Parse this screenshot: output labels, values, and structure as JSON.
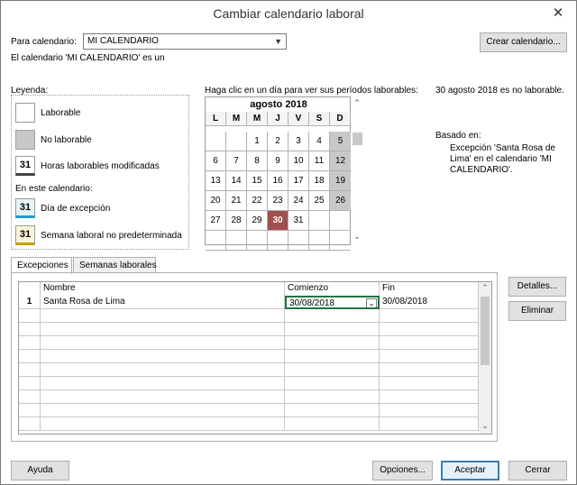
{
  "title": "Cambiar calendario laboral",
  "close_glyph": "✕",
  "for_calendar_label": "Para calendario:",
  "calendar_value": "MI CALENDARIO",
  "create_calendar_button": "Crear calendario...",
  "calendar_info": "El calendario 'MI CALENDARIO' es un",
  "legend": {
    "title": "Leyenda:",
    "items": [
      {
        "swatch": "",
        "label": "Laborable"
      },
      {
        "swatch": "",
        "label": "No laborable"
      },
      {
        "swatch": "31",
        "label": "Horas laborables modificadas"
      }
    ],
    "in_calendar_title": "En este calendario:",
    "calendar_items": [
      {
        "swatch": "31",
        "label": "Día de excepción"
      },
      {
        "swatch": "31",
        "label": "Semana laboral no predeterminada"
      }
    ]
  },
  "calendar_prompt": "Haga clic en un día para ver sus períodos laborables:",
  "calendar": {
    "month": "agosto 2018",
    "weekdays": [
      "L",
      "M",
      "M",
      "J",
      "V",
      "S",
      "D"
    ],
    "weeks": [
      [
        "",
        "",
        "1",
        "2",
        "3",
        "4",
        "5"
      ],
      [
        "6",
        "7",
        "8",
        "9",
        "10",
        "11",
        "12"
      ],
      [
        "13",
        "14",
        "15",
        "16",
        "17",
        "18",
        "19"
      ],
      [
        "20",
        "21",
        "22",
        "23",
        "24",
        "25",
        "26"
      ],
      [
        "27",
        "28",
        "29",
        "30",
        "31",
        "",
        ""
      ],
      [
        "",
        "",
        "",
        "",
        "",
        "",
        ""
      ]
    ],
    "selected_day": "30",
    "nonworking_days": [
      "5",
      "12",
      "19",
      "26"
    ]
  },
  "day_status": "30 agosto 2018 es no laborable.",
  "based_on": {
    "title": "Basado en:",
    "text": "Excepción 'Santa Rosa de Lima' en el calendario 'MI CALENDARIO'."
  },
  "tabs": [
    {
      "label": "Excepciones",
      "active": true
    },
    {
      "label": "Semanas laborales",
      "active": false
    }
  ],
  "table": {
    "headers": [
      "Nombre",
      "Comienzo",
      "Fin"
    ],
    "rows": [
      {
        "num": "1",
        "name": "Santa Rosa de Lima",
        "start": "30/08/2018",
        "end": "30/08/2018"
      }
    ]
  },
  "details_button": "Detalles...",
  "delete_button": "Eliminar",
  "help_button": "Ayuda",
  "options_button": "Opciones...",
  "accept_button": "Aceptar",
  "cancel_button": "Cerrar",
  "colors": {
    "nonworking": "#c8c8c8",
    "selected_day": "#a0504e",
    "exception_bar": "#1a9bd0",
    "nondefault_bar": "#c8a000",
    "default_button_border": "#3c7fb1"
  }
}
